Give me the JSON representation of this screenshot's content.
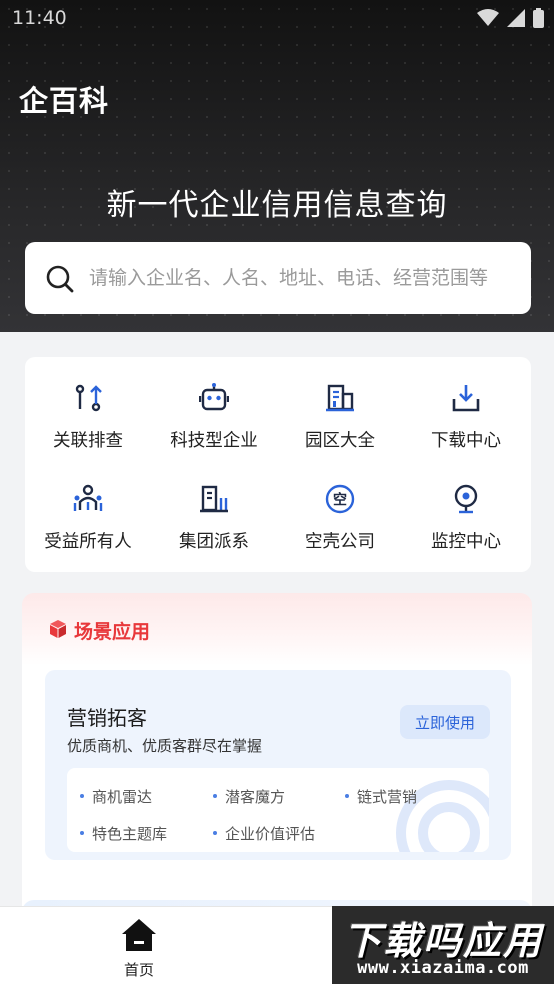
{
  "status_bar": {
    "time": "11:40"
  },
  "header": {
    "brand": "企百科",
    "headline": "新一代企业信用信息查询"
  },
  "search": {
    "placeholder": "请输入企业名、人名、地址、电话、经营范围等"
  },
  "tools": [
    {
      "label": "关联排查",
      "icon": "link-trace-icon"
    },
    {
      "label": "科技型企业",
      "icon": "robot-icon"
    },
    {
      "label": "园区大全",
      "icon": "building-park-icon"
    },
    {
      "label": "下载中心",
      "icon": "download-icon"
    },
    {
      "label": "受益所有人",
      "icon": "beneficiary-people-icon"
    },
    {
      "label": "集团派系",
      "icon": "group-building-icon"
    },
    {
      "label": "空壳公司",
      "icon": "empty-shell-icon"
    },
    {
      "label": "监控中心",
      "icon": "camera-monitor-icon"
    }
  ],
  "scene": {
    "title": "场景应用",
    "marketing": {
      "title": "营销拓客",
      "subtitle": "优质商机、优质客群尽在掌握",
      "button": "立即使用",
      "features": [
        "商机雷达",
        "潜客魔方",
        "链式营销",
        "特色主题库",
        "企业价值评估"
      ]
    }
  },
  "bottom_nav": {
    "home_label": "首页"
  },
  "promo": {
    "main": "下载吗应用",
    "url": "www.xiazaima.com"
  },
  "colors": {
    "accent_blue": "#2b63d9",
    "scene_red": "#e8383b",
    "hero_bg": "#1d1d1f"
  }
}
